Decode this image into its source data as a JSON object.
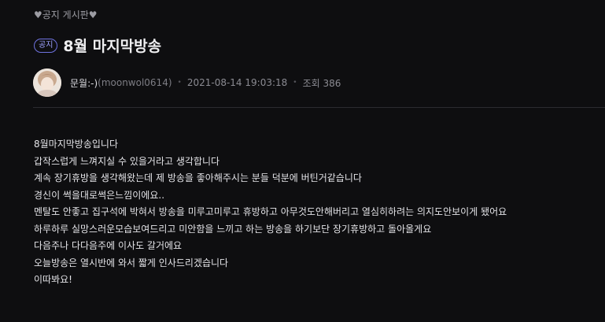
{
  "board": {
    "link_label": "♥공지 게시판♥"
  },
  "post": {
    "tag": "공지",
    "title": "8월 마지막방송",
    "author_name": "문월:-)",
    "author_id": "(moonwol0614)",
    "date": "2021-08-14 19:03:18",
    "views_label": "조회 386",
    "body": [
      "8월마지막방송입니다",
      "갑작스럽게 느껴지실 수 있을거라고 생각합니다",
      "계속 장기휴방을 생각해왔는데 제 방송을 좋아해주시는 분들 덕분에 버틴거같습니다",
      "경신이 썩을대로썩은느낌이에요..",
      "멘탈도 안좋고 집구석에 박혀서 방송을 미루고미루고 휴방하고 아무것도안해버리고 열심히하려는 의지도안보이게 됐어요",
      "하루하루 실망스러운모습보여드리고 미안함을 느끼고 하는 방송을 하기보단 장기휴방하고 돌아올게요",
      "다음주나 다다음주에 이사도 갈거에요",
      "오늘방송은 열시반에 와서 짧게 인사드리겠습니다",
      "이따봐요!"
    ]
  },
  "colors": {
    "background": "#0e0e10",
    "tag_accent": "#6f73e0",
    "text": "#e4e4e8",
    "muted": "#8b8b92"
  },
  "icons": {
    "avatar": "user-avatar"
  }
}
